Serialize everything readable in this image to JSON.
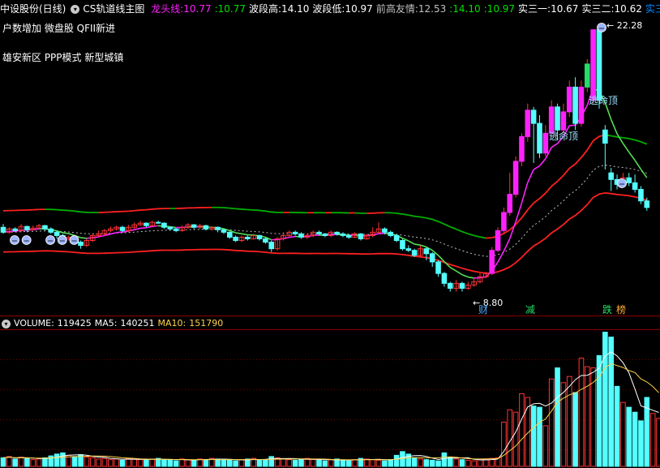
{
  "header": {
    "stock": "中设股份(日线)",
    "indicator": "CS轨道线主图",
    "items": [
      {
        "label": "龙头线:",
        "value": "10.77",
        "color": "#ff22ff"
      },
      {
        "label": ":",
        "value": "10.77",
        "color": "#00e000"
      },
      {
        "label": "波段高:",
        "value": "14.10",
        "color": "#ffffff"
      },
      {
        "label": "波段低:",
        "value": "10.97",
        "color": "#ffffff"
      },
      {
        "label": "前高友情:",
        "value": "12.53",
        "color": "#c0c0c0"
      },
      {
        "label": ":",
        "value": "14.10",
        "color": "#00e000"
      },
      {
        "label": ":",
        "value": "10.97",
        "color": "#00e000"
      },
      {
        "label": "实三一:",
        "value": "10.67",
        "color": "#ffffff"
      },
      {
        "label": "实三二:",
        "value": "10.62",
        "color": "#ffffff"
      },
      {
        "label": "实三",
        "value": "",
        "color": "#0088ff"
      }
    ]
  },
  "tags": {
    "line1": "户数增加 微盘股 QFII新进",
    "line2": "雄安新区 PPP模式 新型城镇"
  },
  "annotations": {
    "high_price": "22.28",
    "low_price": "8.80",
    "escape_top": "逃命顶",
    "marker_cai": "财",
    "marker_jian": "减",
    "marker_die": "跌",
    "marker_bang": "榜"
  },
  "volume_header": {
    "volume_label": "VOLUME:",
    "volume_value": "119425",
    "ma5_label": "MA5:",
    "ma5_value": "140251",
    "ma10_label": "MA10:",
    "ma10_value": "151790"
  },
  "colors": {
    "up": "#ff3333",
    "down": "#54ffff",
    "magenta": "#ff22ff",
    "green_band": "#00b000",
    "red_band": "#ff2020",
    "vol_grid": "#7a0000"
  },
  "chart_data": {
    "type": "candlestick",
    "price_range": [
      5.0,
      23.0
    ],
    "candles": [
      {
        "o": 10.3,
        "c": 10.0,
        "h": 10.5,
        "l": 9.9
      },
      {
        "o": 10.0,
        "c": 10.2,
        "h": 10.3,
        "l": 9.9
      },
      {
        "o": 10.2,
        "c": 10.1,
        "h": 10.3,
        "l": 10.0
      },
      {
        "o": 10.1,
        "c": 10.35,
        "h": 10.5,
        "l": 10.0
      },
      {
        "o": 10.35,
        "c": 10.15,
        "h": 10.4,
        "l": 10.0
      },
      {
        "o": 10.15,
        "c": 10.25,
        "h": 10.4,
        "l": 10.1
      },
      {
        "o": 10.25,
        "c": 10.4,
        "h": 10.5,
        "l": 10.2
      },
      {
        "o": 10.4,
        "c": 10.2,
        "h": 10.45,
        "l": 10.1
      },
      {
        "o": 10.2,
        "c": 10.0,
        "h": 10.3,
        "l": 9.9
      },
      {
        "o": 10.0,
        "c": 9.8,
        "h": 10.1,
        "l": 9.6
      },
      {
        "o": 9.8,
        "c": 9.6,
        "h": 9.9,
        "l": 9.4
      },
      {
        "o": 9.6,
        "c": 9.7,
        "h": 9.8,
        "l": 9.5
      },
      {
        "o": 9.7,
        "c": 9.4,
        "h": 9.8,
        "l": 9.3
      },
      {
        "o": 9.4,
        "c": 9.2,
        "h": 9.5,
        "l": 9.0
      },
      {
        "o": 9.2,
        "c": 9.5,
        "h": 9.6,
        "l": 9.1
      },
      {
        "o": 9.5,
        "c": 9.8,
        "h": 9.9,
        "l": 9.4
      },
      {
        "o": 9.8,
        "c": 9.9,
        "h": 10.1,
        "l": 9.7
      },
      {
        "o": 9.9,
        "c": 10.1,
        "h": 10.2,
        "l": 9.8
      },
      {
        "o": 10.1,
        "c": 10.2,
        "h": 10.35,
        "l": 10.0
      },
      {
        "o": 10.2,
        "c": 10.3,
        "h": 10.4,
        "l": 10.1
      },
      {
        "o": 10.3,
        "c": 10.1,
        "h": 10.4,
        "l": 10.0
      },
      {
        "o": 10.1,
        "c": 10.3,
        "h": 10.45,
        "l": 10.0
      },
      {
        "o": 10.3,
        "c": 10.45,
        "h": 10.6,
        "l": 10.2
      },
      {
        "o": 10.45,
        "c": 10.55,
        "h": 10.7,
        "l": 10.4
      },
      {
        "o": 10.55,
        "c": 10.4,
        "h": 10.6,
        "l": 10.3
      },
      {
        "o": 10.4,
        "c": 10.6,
        "h": 10.7,
        "l": 10.35
      },
      {
        "o": 10.6,
        "c": 10.55,
        "h": 10.7,
        "l": 10.5
      },
      {
        "o": 10.55,
        "c": 10.3,
        "h": 10.6,
        "l": 10.2
      },
      {
        "o": 10.3,
        "c": 10.2,
        "h": 10.35,
        "l": 10.1
      },
      {
        "o": 10.2,
        "c": 10.1,
        "h": 10.25,
        "l": 10.0
      },
      {
        "o": 10.1,
        "c": 10.3,
        "h": 10.4,
        "l": 10.05
      },
      {
        "o": 10.3,
        "c": 10.45,
        "h": 10.55,
        "l": 10.2
      },
      {
        "o": 10.45,
        "c": 10.3,
        "h": 10.5,
        "l": 10.2
      },
      {
        "o": 10.3,
        "c": 10.4,
        "h": 10.5,
        "l": 10.2
      },
      {
        "o": 10.4,
        "c": 10.2,
        "h": 10.45,
        "l": 10.1
      },
      {
        "o": 10.2,
        "c": 10.3,
        "h": 10.35,
        "l": 10.1
      },
      {
        "o": 10.3,
        "c": 10.15,
        "h": 10.35,
        "l": 10.0
      },
      {
        "o": 10.15,
        "c": 10.0,
        "h": 10.2,
        "l": 9.9
      },
      {
        "o": 10.0,
        "c": 9.7,
        "h": 10.05,
        "l": 9.6
      },
      {
        "o": 9.7,
        "c": 9.5,
        "h": 9.8,
        "l": 9.4
      },
      {
        "o": 9.5,
        "c": 9.7,
        "h": 9.8,
        "l": 9.4
      },
      {
        "o": 9.7,
        "c": 9.6,
        "h": 9.8,
        "l": 9.5
      },
      {
        "o": 9.6,
        "c": 9.8,
        "h": 9.9,
        "l": 9.55
      },
      {
        "o": 9.8,
        "c": 9.6,
        "h": 9.85,
        "l": 9.5
      },
      {
        "o": 9.6,
        "c": 9.4,
        "h": 9.7,
        "l": 9.3
      },
      {
        "o": 9.4,
        "c": 9.0,
        "h": 9.5,
        "l": 8.8
      },
      {
        "o": 9.0,
        "c": 9.6,
        "h": 9.7,
        "l": 8.9
      },
      {
        "o": 9.6,
        "c": 9.8,
        "h": 10.0,
        "l": 9.5
      },
      {
        "o": 9.8,
        "c": 10.0,
        "h": 10.1,
        "l": 9.7
      },
      {
        "o": 10.0,
        "c": 9.9,
        "h": 10.1,
        "l": 9.8
      },
      {
        "o": 9.9,
        "c": 9.7,
        "h": 10.0,
        "l": 9.6
      },
      {
        "o": 9.7,
        "c": 9.8,
        "h": 9.9,
        "l": 9.6
      },
      {
        "o": 9.8,
        "c": 10.0,
        "h": 10.1,
        "l": 9.7
      },
      {
        "o": 10.0,
        "c": 9.9,
        "h": 10.1,
        "l": 9.85
      },
      {
        "o": 9.9,
        "c": 9.8,
        "h": 9.95,
        "l": 9.7
      },
      {
        "o": 9.8,
        "c": 10.0,
        "h": 10.1,
        "l": 9.7
      },
      {
        "o": 10.0,
        "c": 9.9,
        "h": 10.05,
        "l": 9.8
      },
      {
        "o": 9.9,
        "c": 9.8,
        "h": 10.0,
        "l": 9.7
      },
      {
        "o": 9.8,
        "c": 9.7,
        "h": 9.9,
        "l": 9.6
      },
      {
        "o": 9.7,
        "c": 9.9,
        "h": 10.0,
        "l": 9.65
      },
      {
        "o": 9.9,
        "c": 9.6,
        "h": 9.95,
        "l": 9.5
      },
      {
        "o": 9.6,
        "c": 9.8,
        "h": 9.9,
        "l": 9.55
      },
      {
        "o": 9.8,
        "c": 10.0,
        "h": 10.3,
        "l": 9.7
      },
      {
        "o": 10.0,
        "c": 10.2,
        "h": 10.6,
        "l": 9.9
      },
      {
        "o": 10.2,
        "c": 10.0,
        "h": 10.3,
        "l": 9.9
      },
      {
        "o": 10.0,
        "c": 9.8,
        "h": 10.1,
        "l": 9.7
      },
      {
        "o": 9.8,
        "c": 9.5,
        "h": 9.9,
        "l": 9.4
      },
      {
        "o": 9.5,
        "c": 9.0,
        "h": 9.6,
        "l": 8.9
      },
      {
        "o": 9.0,
        "c": 8.9,
        "h": 9.2,
        "l": 8.8
      },
      {
        "o": 8.9,
        "c": 8.6,
        "h": 9.0,
        "l": 8.5
      },
      {
        "o": 8.6,
        "c": 9.0,
        "h": 9.2,
        "l": 8.5
      },
      {
        "o": 9.0,
        "c": 8.7,
        "h": 9.1,
        "l": 8.3
      },
      {
        "o": 8.7,
        "c": 8.2,
        "h": 8.8,
        "l": 7.9
      },
      {
        "o": 8.2,
        "c": 7.5,
        "h": 8.3,
        "l": 7.3
      },
      {
        "o": 7.5,
        "c": 6.9,
        "h": 7.6,
        "l": 6.7
      },
      {
        "o": 6.9,
        "c": 6.6,
        "h": 7.0,
        "l": 6.4
      },
      {
        "o": 6.6,
        "c": 6.9,
        "h": 7.1,
        "l": 6.4
      },
      {
        "o": 6.9,
        "c": 6.6,
        "h": 7.0,
        "l": 6.4
      },
      {
        "o": 6.6,
        "c": 6.8,
        "h": 7.0,
        "l": 6.5
      },
      {
        "o": 6.8,
        "c": 7.0,
        "h": 7.2,
        "l": 6.7
      },
      {
        "o": 7.0,
        "c": 7.3,
        "h": 7.5,
        "l": 6.9
      },
      {
        "o": 7.3,
        "c": 7.5,
        "h": 7.6,
        "l": 7.2
      },
      {
        "o": 7.5,
        "c": 8.9,
        "h": 9.1,
        "l": 7.4
      },
      {
        "o": 8.9,
        "c": 10.1,
        "h": 10.3,
        "l": 8.8
      },
      {
        "o": 10.1,
        "c": 11.2,
        "h": 11.5,
        "l": 9.9
      },
      {
        "o": 11.2,
        "c": 12.3,
        "h": 13.6,
        "l": 11.0
      },
      {
        "o": 12.3,
        "c": 14.3,
        "h": 14.6,
        "l": 12.1
      },
      {
        "o": 14.3,
        "c": 15.8,
        "h": 16.0,
        "l": 14.0
      },
      {
        "o": 15.8,
        "c": 17.4,
        "h": 17.8,
        "l": 15.5
      },
      {
        "o": 17.4,
        "c": 16.6,
        "h": 17.6,
        "l": 14.2
      },
      {
        "o": 16.6,
        "c": 14.8,
        "h": 17.1,
        "l": 14.5
      },
      {
        "o": 14.8,
        "c": 16.0,
        "h": 16.5,
        "l": 14.6
      },
      {
        "o": 16.0,
        "c": 17.6,
        "h": 18.0,
        "l": 15.8
      },
      {
        "o": 17.6,
        "c": 16.2,
        "h": 17.8,
        "l": 15.6
      },
      {
        "o": 16.2,
        "c": 17.3,
        "h": 17.8,
        "l": 16.0
      },
      {
        "o": 17.3,
        "c": 18.8,
        "h": 19.2,
        "l": 17.0
      },
      {
        "o": 18.8,
        "c": 16.6,
        "h": 19.4,
        "l": 16.2
      },
      {
        "o": 16.6,
        "c": 18.8,
        "h": 19.2,
        "l": 16.4
      },
      {
        "o": 18.8,
        "c": 20.2,
        "h": 20.5,
        "l": 18.5
      },
      {
        "o": 18.0,
        "c": 22.28,
        "h": 22.28,
        "l": 17.8
      },
      {
        "o": 22.28,
        "c": 18.0,
        "h": 22.3,
        "l": 17.5
      },
      {
        "o": 16.2,
        "c": 15.4,
        "h": 16.5,
        "l": 13.8
      },
      {
        "o": 13.6,
        "c": 13.2,
        "h": 13.9,
        "l": 12.5
      },
      {
        "o": 13.2,
        "c": 12.9,
        "h": 13.5,
        "l": 12.6
      },
      {
        "o": 12.9,
        "c": 13.3,
        "h": 13.6,
        "l": 12.7
      },
      {
        "o": 13.3,
        "c": 13.0,
        "h": 13.6,
        "l": 12.8
      },
      {
        "o": 13.0,
        "c": 12.6,
        "h": 13.5,
        "l": 12.4
      },
      {
        "o": 12.6,
        "c": 11.9,
        "h": 12.8,
        "l": 11.7
      },
      {
        "o": 11.9,
        "c": 11.5,
        "h": 12.1,
        "l": 11.3
      }
    ],
    "volume": [
      14,
      16,
      12,
      15,
      13,
      11,
      12,
      14,
      17,
      20,
      22,
      18,
      16,
      19,
      15,
      14,
      12,
      13,
      11,
      12,
      10,
      13,
      12,
      11,
      10,
      12,
      13,
      11,
      10,
      9,
      12,
      11,
      10,
      12,
      11,
      13,
      12,
      11,
      10,
      9,
      11,
      12,
      13,
      10,
      11,
      16,
      14,
      12,
      11,
      10,
      12,
      13,
      11,
      10,
      9,
      11,
      12,
      10,
      9,
      11,
      13,
      12,
      11,
      10,
      9,
      11,
      18,
      24,
      20,
      14,
      12,
      11,
      10,
      9,
      22,
      15,
      12,
      11,
      10,
      9,
      11,
      12,
      13,
      14,
      72,
      92,
      88,
      118,
      112,
      98,
      96,
      66,
      142,
      160,
      136,
      146,
      120,
      176,
      162,
      160,
      180,
      218,
      210,
      130,
      104,
      96,
      88,
      74,
      112,
      86,
      78
    ],
    "vol_max": 220
  }
}
